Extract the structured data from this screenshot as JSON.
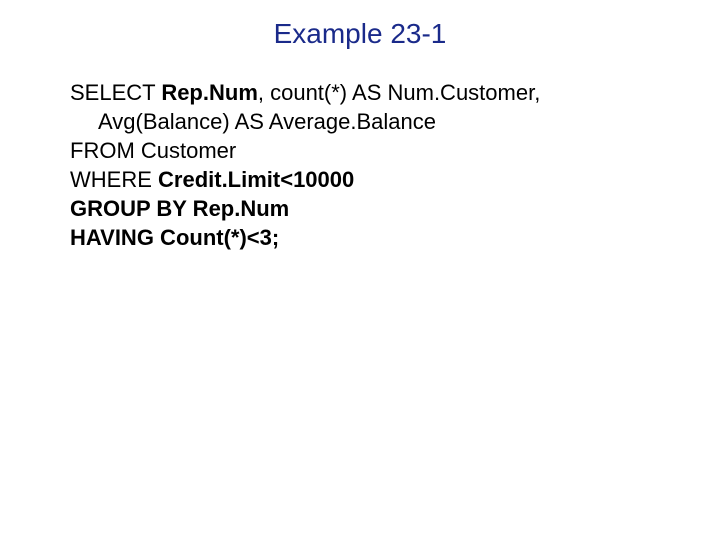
{
  "title": "Example 23-1",
  "sql": {
    "l1a": "SELECT ",
    "l1b": "Rep.Num",
    "l1c": ", count(*) AS Num.Customer,",
    "l2": "Avg(Balance) AS Average.Balance",
    "l3a": "FROM",
    "l3b": " Customer",
    "l4a": "WHERE",
    "l4b": " Credit.Limit<10000",
    "l5a": "GROUP BY",
    "l5b": " Rep.Num",
    "l6a": "HAVING",
    "l6b": " Count(*)<3;"
  }
}
